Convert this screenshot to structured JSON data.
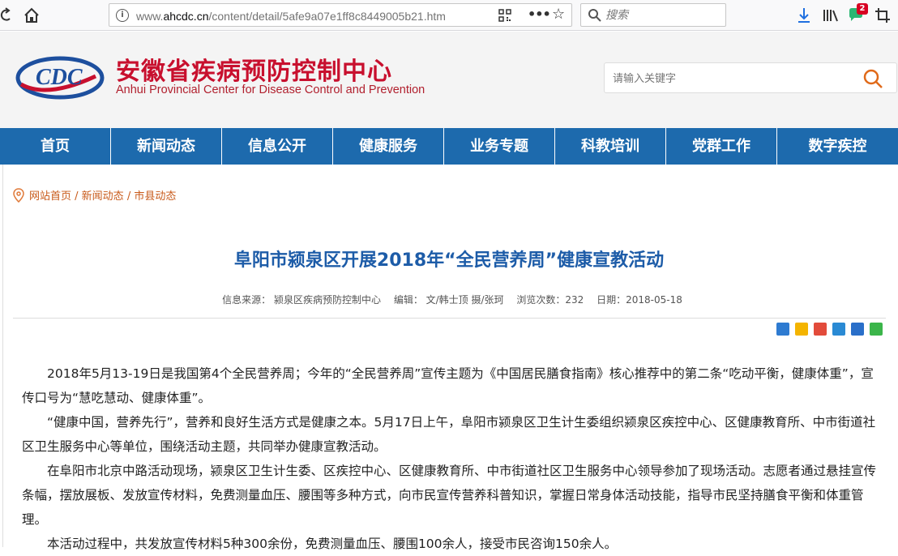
{
  "browser": {
    "url_prefix": "www.",
    "url_domain": "ahcdc.cn",
    "url_path": "/content/detail/5afe9a07e1ff8c8449005b21.htm",
    "search_placeholder": "搜索",
    "badge_count": "2"
  },
  "site": {
    "title": "安徽省疾病预防控制中心",
    "subtitle": "Anhui Provincial Center for Disease Control and Prevention",
    "search_placeholder": "请输入关键字"
  },
  "nav": {
    "items": [
      "首页",
      "新闻动态",
      "信息公开",
      "健康服务",
      "业务专题",
      "科教培训",
      "党群工作",
      "数字疾控"
    ]
  },
  "breadcrumb": {
    "home": "网站首页",
    "sep": " / ",
    "level1": "新闻动态",
    "level2": "市县动态"
  },
  "article": {
    "title": "阜阳市颍泉区开展2018年“全民营养周”健康宣教活动",
    "meta": {
      "source": "信息来源： 颍泉区疾病预防控制中心",
      "editor": "编辑： 文/韩士顶 摄/张珂",
      "views": "浏览次数：232",
      "date": "日期：2018-05-18"
    },
    "paragraphs": [
      "2018年5月13-19日是我国第4个全民营养周；今年的“全民营养周”宣传主题为《中国居民膳食指南》核心推荐中的第二条“吃动平衡，健康体重”，宣传口号为“慧吃慧动、健康体重”。",
      "“健康中国，营养先行”，营养和良好生活方式是健康之本。5月17日上午，阜阳市颍泉区卫生计生委组织颍泉区疾控中心、区健康教育所、中市街道社区卫生服务中心等单位，围绕活动主题，共同举办健康宣教活动。",
      "在阜阳市北京中路活动现场，颍泉区卫生计生委、区疾控中心、区健康教育所、中市街道社区卫生服务中心领导参加了现场活动。志愿者通过悬挂宣传条幅，摆放展板、发放宣传材料，免费测量血压、腰围等多种方式，向市民宣传营养科普知识，掌握日常身体活动技能，指导市民坚持膳食平衡和体重管理。",
      "本活动过程中，共发放宣传材料5种300余份，免费测量血压、腰围100余人，接受市民咨询150余人。"
    ]
  },
  "share": {
    "icons": [
      "share-plus-icon",
      "qzone-icon",
      "weibo-icon",
      "tencent-weibo-icon",
      "renren-icon",
      "wechat-icon"
    ],
    "colors": [
      "#2e7bd1",
      "#f4b400",
      "#e24b3b",
      "#2a8ad4",
      "#2a6fc9",
      "#3bb54a"
    ]
  }
}
